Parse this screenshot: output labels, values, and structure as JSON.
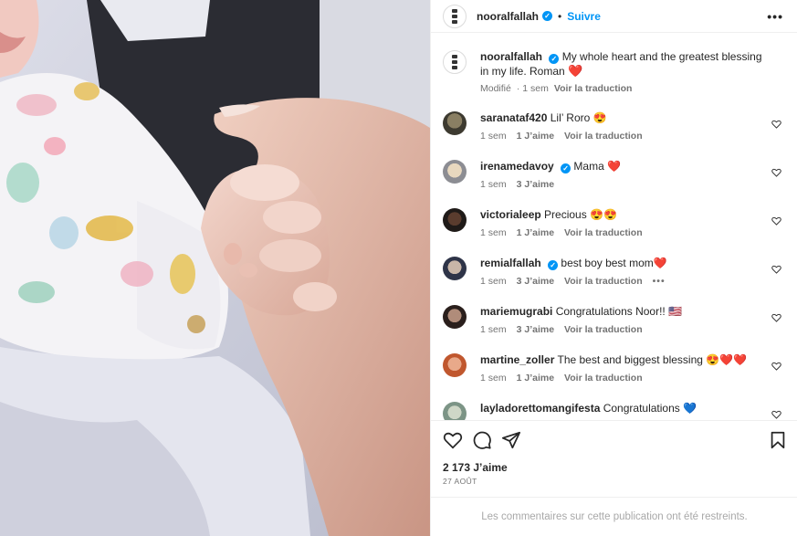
{
  "post": {
    "username": "nooralfallah",
    "follow_label": "Suivre",
    "more_icon": "more-dots-icon",
    "caption_text": "My whole heart and the greatest blessing in my life. Roman",
    "caption_emoji": "❤️",
    "caption_edited": "Modifié",
    "caption_time": "1 sem",
    "caption_translate": "Voir la traduction",
    "likes": "2 173 J’aime",
    "date": "27 AOÛT",
    "restricted_notice": "Les commentaires sur cette publication ont été restreints."
  },
  "comments": [
    {
      "user": "saranataf420",
      "text": "Lil’ Roro",
      "emoji": "😍",
      "time": "1 sem",
      "likes": "1 J’aime",
      "translate": "Voir la traduction",
      "verified": false
    },
    {
      "user": "irenamedavoy",
      "text": "Mama",
      "emoji": "❤️",
      "time": "1 sem",
      "likes": "3 J’aime",
      "translate": "",
      "verified": true
    },
    {
      "user": "victorialeep",
      "text": "Precious",
      "emoji": "😍😍",
      "time": "1 sem",
      "likes": "1 J’aime",
      "translate": "Voir la traduction",
      "verified": false
    },
    {
      "user": "remialfallah",
      "text": "best boy best mom",
      "emoji": "❤️",
      "time": "1 sem",
      "likes": "3 J’aime",
      "translate": "Voir la traduction",
      "verified": true,
      "more": "•••"
    },
    {
      "user": "mariemugrabi",
      "text": "Congratulations Noor!!",
      "emoji": "🇺🇸",
      "time": "1 sem",
      "likes": "3 J’aime",
      "translate": "Voir la traduction",
      "verified": false
    },
    {
      "user": "martine_zoller",
      "text": "The best and biggest blessing",
      "emoji": "😍❤️❤️",
      "time": "1 sem",
      "likes": "1 J’aime",
      "translate": "Voir la traduction",
      "verified": false
    },
    {
      "user": "layladorettomangifesta",
      "text": "Congratulations",
      "emoji": "💙",
      "time": "",
      "likes": "",
      "translate": "",
      "verified": false
    }
  ],
  "icons": {
    "like": "heart-outline-icon",
    "comment": "comment-bubble-icon",
    "share": "paper-plane-icon",
    "save": "bookmark-icon"
  },
  "colors": {
    "accent": "#0095f6",
    "text": "#262626",
    "muted": "#737373",
    "divider": "#efefef"
  }
}
